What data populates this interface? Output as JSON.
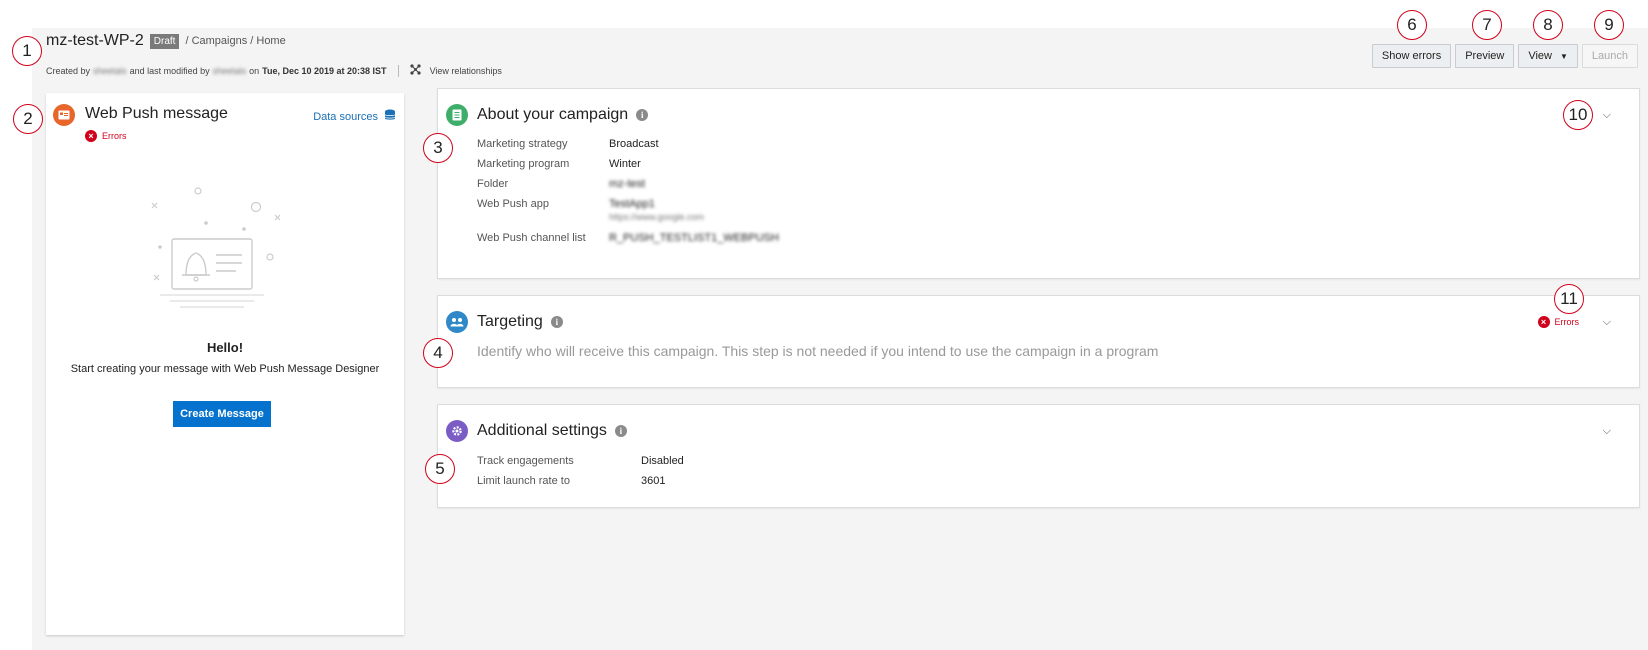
{
  "header": {
    "title": "mz-test-WP-2",
    "badge": "Draft",
    "breadcrumb": "/ Campaigns / Home",
    "meta": {
      "created_by_prefix": "Created by",
      "created_by_user": "sheetals",
      "modified_by_text": "and last modified by",
      "modified_by_user": "sheetals",
      "on_text": "on",
      "date": "Tue, Dec 10 2019 at 20:38 IST"
    },
    "view_relationships": "View relationships"
  },
  "toolbar": {
    "show_errors": "Show errors",
    "preview": "Preview",
    "view": "View",
    "launch": "Launch"
  },
  "left_panel": {
    "title": "Web Push message",
    "errors": "Errors",
    "data_sources": "Data sources",
    "hello": "Hello!",
    "start_text": "Start creating your message with Web Push Message Designer",
    "create_button": "Create Message"
  },
  "about": {
    "title": "About your campaign",
    "fields": [
      {
        "label": "Marketing strategy",
        "value": "Broadcast"
      },
      {
        "label": "Marketing program",
        "value": "Winter"
      },
      {
        "label": "Folder",
        "value": "mz-test"
      },
      {
        "label": "Web Push app",
        "value": "TestApp1",
        "sub": "https://www.google.com"
      },
      {
        "label": "Web Push channel list",
        "value": "R_PUSH_TESTLIST1_WEBPUSH"
      }
    ]
  },
  "targeting": {
    "title": "Targeting",
    "errors": "Errors",
    "description": "Identify who will receive this campaign. This step is not needed if you intend to use the campaign in a program"
  },
  "additional": {
    "title": "Additional settings",
    "fields": [
      {
        "label": "Track engagements",
        "value": "Disabled"
      },
      {
        "label": "Limit launch rate to",
        "value": "3601"
      }
    ]
  },
  "callouts": [
    "1",
    "2",
    "3",
    "4",
    "5",
    "6",
    "7",
    "8",
    "9",
    "10",
    "11"
  ],
  "colors": {
    "accent_blue": "#0572ce",
    "error_red": "#d0021b",
    "web_push_orange": "#e8662a",
    "about_green": "#3fae6a",
    "targeting_blue": "#2f88c8",
    "settings_purple": "#7a5cc4"
  }
}
